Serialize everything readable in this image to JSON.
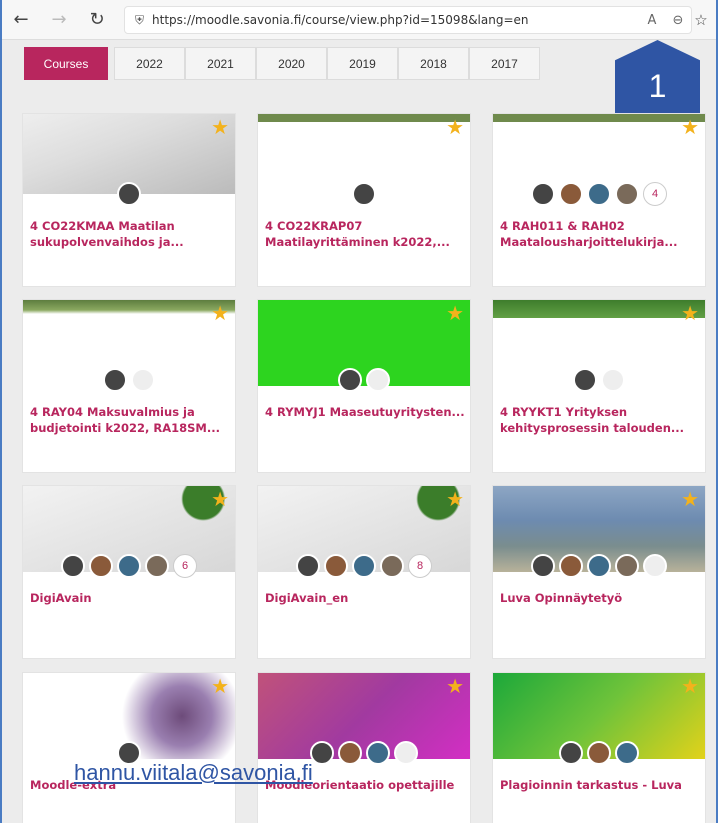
{
  "browser": {
    "url": "https://moodle.savonia.fi/course/view.php?id=15098&lang=en",
    "back_icon": "←",
    "forward_icon": "→",
    "refresh_icon": "↻",
    "lock_icon": "🔒",
    "read_aloud": "A",
    "zoom_icon": "⊖",
    "favorite_icon": "☆"
  },
  "tabs": [
    {
      "label": "Courses",
      "active": true
    },
    {
      "label": "2022"
    },
    {
      "label": "2021"
    },
    {
      "label": "2020"
    },
    {
      "label": "2019"
    },
    {
      "label": "2018"
    },
    {
      "label": "2017"
    }
  ],
  "badge": "1",
  "cards": [
    {
      "title": "4 CO22KMAA Maatilan sukupolvenvaihdos ja...",
      "count": "",
      "img": "calculator",
      "avatars": 1,
      "empties": 0
    },
    {
      "title": "4 CO22KRAP07 Maatilayrittäminen k2022,...",
      "count": "",
      "img": "field",
      "avatars": 1,
      "empties": 0
    },
    {
      "title": "4 RAH011 & RAH02 Maatalousharjoittelukirja...",
      "count": "4",
      "img": "field",
      "avatars": 4,
      "empties": 0
    },
    {
      "title": "4 RAY04 Maksuvalmius ja budjetointi k2022, RA18SM...",
      "count": "",
      "img": "cows",
      "avatars": 1,
      "empties": 1
    },
    {
      "title": "4 RYMYJ1 Maaseutuyritysten...",
      "count": "",
      "img": "green",
      "avatars": 1,
      "empties": 1
    },
    {
      "title": "4 RYYKT1 Yrityksen kehitysprosessin talouden...",
      "count": "",
      "img": "tractor",
      "avatars": 1,
      "empties": 1
    },
    {
      "title": "DigiAvain",
      "count": "6",
      "img": "desk",
      "avatars": 4,
      "empties": 0
    },
    {
      "title": "DigiAvain_en",
      "count": "8",
      "img": "desk",
      "avatars": 4,
      "empties": 0
    },
    {
      "title": "Luva Opinnäytetyö",
      "count": "",
      "img": "lake",
      "avatars": 4,
      "empties": 1
    },
    {
      "title": "Moodle-extra",
      "count": "",
      "img": "robot",
      "avatars": 1,
      "empties": 0
    },
    {
      "title": "Moodleorientaatio opettajille",
      "count": "",
      "img": "magenta",
      "avatars": 3,
      "empties": 1
    },
    {
      "title": "Plagioinnin tarkastus - Luva",
      "count": "",
      "img": "lime",
      "avatars": 3,
      "empties": 0
    }
  ],
  "email": "hannu.viitala@savonia.fi",
  "colors": {
    "accent": "#b8265e",
    "star": "#f3b21c",
    "badge": "#2f55a4"
  }
}
